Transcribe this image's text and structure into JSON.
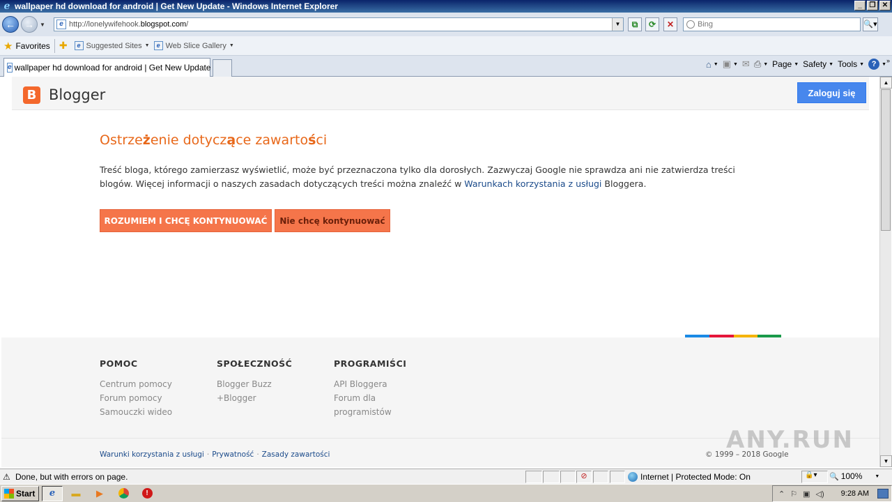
{
  "window": {
    "title": "wallpaper hd download for android | Get New Update - Windows Internet Explorer",
    "controls": [
      "_",
      "❐",
      "✕"
    ]
  },
  "address": {
    "url_prefix": "http://lonelywifehook.",
    "url_domain": "blogspot.com",
    "url_suffix": "/",
    "search_placeholder": "Bing"
  },
  "favorites": {
    "label": "Favorites",
    "links": [
      "Suggested Sites",
      "Web Slice Gallery"
    ]
  },
  "tabs": [
    {
      "label": "wallpaper hd download for android | Get New Update"
    }
  ],
  "commandbar": {
    "page": "Page",
    "safety": "Safety",
    "tools": "Tools"
  },
  "blogger": {
    "logo_letter": "B",
    "name": "Blogger",
    "signin": "Zaloguj się"
  },
  "warning": {
    "title_parts": [
      "Ostrze",
      "ż",
      "enie dotycz",
      "ą",
      "ce zawarto",
      "ś",
      "ci"
    ],
    "body_before_link": "Treść bloga, którego zamierzasz wyświetlić, może być przeznaczona tylko dla dorosłych. Zazwyczaj Google nie sprawdza ani nie zatwierdza treści blogów. Więcej informacji o naszych zasadach dotyczących treści można znaleźć w ",
    "body_link": "Warunkach korzystania z usługi",
    "body_after_link": " Bloggera.",
    "continue_button": "ROZUMIEM I CHCĘ KONTYNUOWAĆ",
    "stop_button": "Nie chcę kontynuować"
  },
  "colors": {
    "accent_orange": "#f5754a",
    "title_orange": "#e8681a",
    "signin_blue": "#4787ed",
    "bar_blue": "#1a8ae5",
    "bar_red": "#e5163a",
    "bar_yellow": "#f5b400",
    "bar_green": "#1a9a4a"
  },
  "footer": {
    "columns": [
      {
        "heading": "POMOC",
        "links": [
          "Centrum pomocy",
          "Forum pomocy",
          "Samouczki wideo"
        ]
      },
      {
        "heading": "SPOŁECZNOŚĆ",
        "links": [
          "Blogger Buzz",
          "+Blogger"
        ]
      },
      {
        "heading": "PROGRAMIŚCI",
        "links": [
          "API Bloggera",
          "Forum dla",
          "programistów"
        ]
      }
    ],
    "bottom_links": [
      "Warunki korzystania z usługi",
      "Prywatność",
      "Zasady zawartości"
    ],
    "copyright": "© 1999 – 2018 Google",
    "watermark": "ANY.RUN"
  },
  "status": {
    "message": "Done, but with errors on page.",
    "zone": "Internet | Protected Mode: On",
    "zoom": "100%"
  },
  "taskbar": {
    "start": "Start",
    "clock": "9:28 AM"
  }
}
